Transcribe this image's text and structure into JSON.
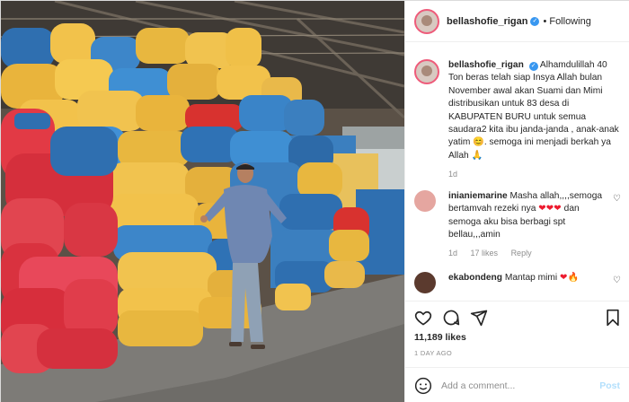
{
  "post": {
    "username": "bellashofie_rigan",
    "follow_status": "Following",
    "separator": "•",
    "caption": {
      "username": "bellashofie_rigan",
      "text": "Alhamdulillah 40 Ton beras telah siap Insya Allah bulan November awal akan Suami dan Mimi distribusikan untuk 83 desa di KABUPATEN BURU untuk semua saudara2 kita ibu janda-janda , anak-anak yatim 😊. semoga ini menjadi berkah ya Allah 🙏",
      "age": "1d"
    },
    "comments": [
      {
        "username": "inianiemarine",
        "text_a": "Masha allah,,,,semoga bertamvah rezeki nya ",
        "hearts_a": "❤❤❤",
        "text_b": " dan semoga aku bisa berbagi spt bellau,,,amin",
        "age": "1d",
        "likes": "17 likes",
        "reply": "Reply"
      },
      {
        "username": "ekabondeng",
        "text_a": "Mantap mimi ",
        "hearts_a": "❤🔥"
      }
    ],
    "likes": "11,189 likes",
    "time_ago": "1 DAY AGO",
    "comment_placeholder": "Add a comment...",
    "post_label": "Post"
  },
  "icons": {
    "verified": "verified-badge",
    "heart": "heart-icon",
    "comment": "comment-icon",
    "share": "share-icon",
    "save": "bookmark-icon",
    "emoji": "emoji-icon"
  },
  "colors": {
    "verified_blue": "#3897f0",
    "post_button_disabled": "#b2dffc",
    "muted_text": "#8e8e8e"
  }
}
